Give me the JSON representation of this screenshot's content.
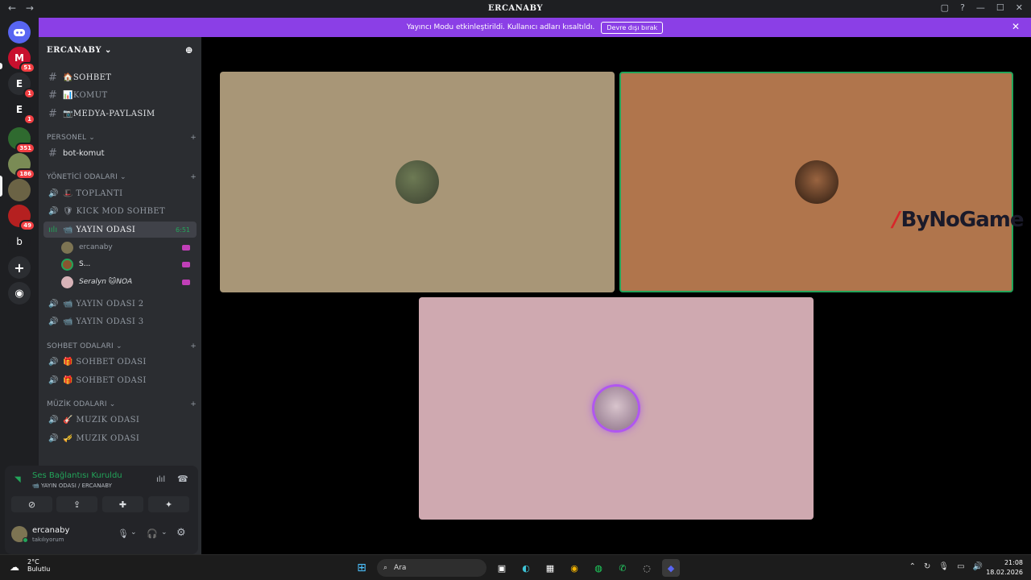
{
  "window": {
    "title": "ERCANABY",
    "back": "←",
    "forward": "→",
    "controls": [
      "▢",
      "?",
      "—",
      "☐",
      "✕"
    ]
  },
  "banner": {
    "text": "Yayıncı Modu etkinleştirildi. Kullanıcı adları kısaltıldı.",
    "button": "Devre dışı bırak",
    "close": "✕"
  },
  "guilds": [
    {
      "label": "M",
      "badge": "51",
      "color": "#c8102e"
    },
    {
      "label": "E",
      "badge": "1",
      "color": "#2b2d31"
    },
    {
      "label": "E",
      "badge": "1",
      "color": "#1e1f22"
    },
    {
      "label": "",
      "badge": "351",
      "color": "#2f6a2f"
    },
    {
      "label": "",
      "badge": "186",
      "color": "#7a8b55"
    },
    {
      "label": "",
      "badge": "",
      "color": "#6b6345"
    },
    {
      "label": "",
      "badge": "49",
      "color": "#b52020"
    },
    {
      "label": "b",
      "badge": "",
      "color": "#1e1f22"
    }
  ],
  "server": {
    "name": "ERCANABY",
    "chevron": "⌄",
    "add_member": "⊕"
  },
  "channels": {
    "text": [
      {
        "icon": "#",
        "label": "🏠SOHBET"
      },
      {
        "icon": "#",
        "label": "📊KOMUT"
      },
      {
        "icon": "#",
        "label": "📷MEDYA-PAYLASIM"
      }
    ],
    "personel_cat": "PERSONEL",
    "personel": [
      {
        "icon": "#",
        "label": "bot-komut"
      }
    ],
    "yonetici_cat": "YÖNETİCİ ODALARI",
    "yonetici": [
      {
        "icon": "🔊",
        "label": "🎩 TOPLANTI"
      },
      {
        "icon": "🔊",
        "label": "🛡 KICK MOD SOHBET"
      },
      {
        "icon": "🔊",
        "label": "📹 YAYIN ODASI",
        "timer": "6:51"
      }
    ],
    "members": [
      {
        "name": "ercanaby"
      },
      {
        "name": "S..."
      },
      {
        "name": "Seralyn 🐱NOA"
      }
    ],
    "yayin_extra": [
      {
        "icon": "🔊",
        "label": "📹 YAYIN ODASI 2"
      },
      {
        "icon": "🔊",
        "label": "📹 YAYIN ODASI 3"
      }
    ],
    "sohbet_cat": "SOHBET ODALARI",
    "sohbet": [
      {
        "icon": "🔊",
        "label": "🎁 SOHBET ODASI"
      },
      {
        "icon": "🔊",
        "label": "🎁 SOHBET ODASI"
      }
    ],
    "muzik_cat": "MÜZİK ODALARI",
    "muzik": [
      {
        "icon": "🔊",
        "label": "🎸 MUZIK ODASI"
      },
      {
        "icon": "🎺",
        "label": "🎺 MUZIK ODASI"
      }
    ],
    "plus": "+",
    "chev": "⌄"
  },
  "voice": {
    "status": "Ses Bağlantısı Kuruldu",
    "sub": "📹 YAYIN ODASI / ERCANABY",
    "buttons": [
      "⊘",
      "⇪",
      "✚",
      "✦"
    ]
  },
  "user": {
    "name": "ercanaby",
    "status": "takılıyorum"
  },
  "tiles": [
    {
      "bg": "#a89677"
    },
    {
      "bg": "#b0754c"
    },
    {
      "bg": "#cfa9b0"
    }
  ],
  "watermark": {
    "slash": "/",
    "text": "ByNoGame"
  },
  "taskbar": {
    "weather_temp": "2°C",
    "weather_desc": "Bulutlu",
    "search": "Ara",
    "time": "21:08",
    "date": "18.02.2026"
  }
}
